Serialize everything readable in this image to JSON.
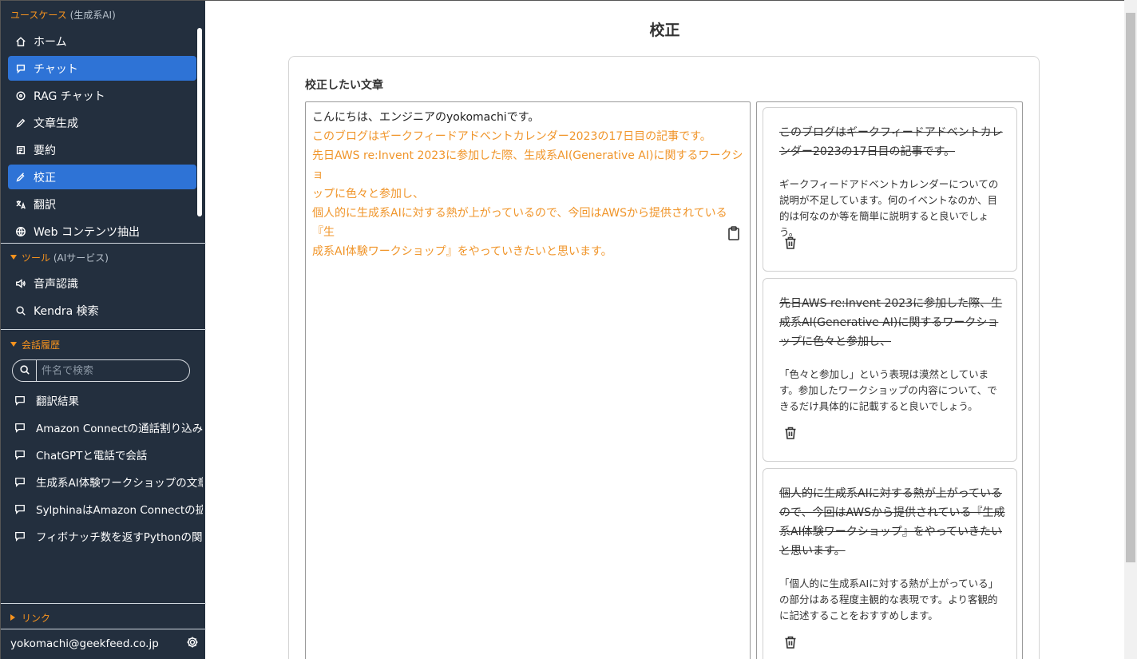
{
  "sidebar": {
    "usecase_section": {
      "title": "ユースケース",
      "sub": "(生成系AI)"
    },
    "items": [
      {
        "label": "ホーム",
        "icon": "home-icon"
      },
      {
        "label": "チャット",
        "icon": "chat-icon"
      },
      {
        "label": "RAG チャット",
        "icon": "rag-chat-icon"
      },
      {
        "label": "文章生成",
        "icon": "pencil-icon"
      },
      {
        "label": "要約",
        "icon": "summary-icon"
      },
      {
        "label": "校正",
        "icon": "proofread-icon"
      },
      {
        "label": "翻訳",
        "icon": "translate-icon"
      },
      {
        "label": "Web コンテンツ抽出",
        "icon": "globe-icon"
      }
    ],
    "tools_section": {
      "title": "ツール",
      "sub": "(AIサービス)"
    },
    "tools": [
      {
        "label": "音声認識",
        "icon": "speaker-icon"
      },
      {
        "label": "Kendra 検索",
        "icon": "search-icon"
      }
    ],
    "history_section": {
      "title": "会話履歴"
    },
    "history_search_placeholder": "件名で検索",
    "history": [
      "翻訳結果",
      "Amazon Connectの通話割り込み",
      "ChatGPTと電話で会話",
      "生成系AI体験ワークショップの文章",
      "SylphinaはAmazon Connectの拡",
      "フィボナッチ数を返すPythonの関数"
    ],
    "links_section": {
      "title": "リンク"
    },
    "user_email": "yokomachi@geekfeed.co.jp"
  },
  "main": {
    "page_title": "校正",
    "input_label": "校正したい文章",
    "editor_lines": [
      "こんにちは、エンジニアのyokomachiです。",
      "このブログはギークフィードアドベントカレンダー2023の17日目の記事です。",
      "先日AWS re:Invent 2023に参加した際、生成系AI(Generative AI)に関するワークショ",
      "ップに色々と参加し、",
      "個人的に生成系AIに対する熱が上がっているので、今回はAWSから提供されている『生",
      "成系AI体験ワークショップ』をやっていきたいと思います。"
    ],
    "corrections": [
      {
        "original": "このブログはギークフィードアドベントカレンダー2023の17日目の記事です。",
        "explanation": "ギークフィードアドベントカレンダーについての説明が不足しています。何のイベントなのか、目的は何なのか等を簡単に説明すると良いでしょう。"
      },
      {
        "original": "先日AWS re:Invent 2023に参加した際、生成系AI(Generative AI)に関するワークショップに色々と参加し、",
        "explanation": "「色々と参加し」という表現は漠然としています。参加したワークショップの内容について、できるだけ具体的に記載すると良いでしょう。"
      },
      {
        "original": "個人的に生成系AIに対する熱が上がっているので、今回はAWSから提供されている『生成系AI体験ワークショップ』をやっていきたいと思います。",
        "explanation": "「個人的に生成系AIに対する熱が上がっている」の部分はある程度主観的な表現です。より客観的に記述することをおすすめします。"
      }
    ]
  },
  "colors": {
    "sidebar_bg": "#232f3e",
    "accent_orange": "#f7931e",
    "active_blue": "#2e73d6",
    "highlight_text": "#f0952a"
  }
}
